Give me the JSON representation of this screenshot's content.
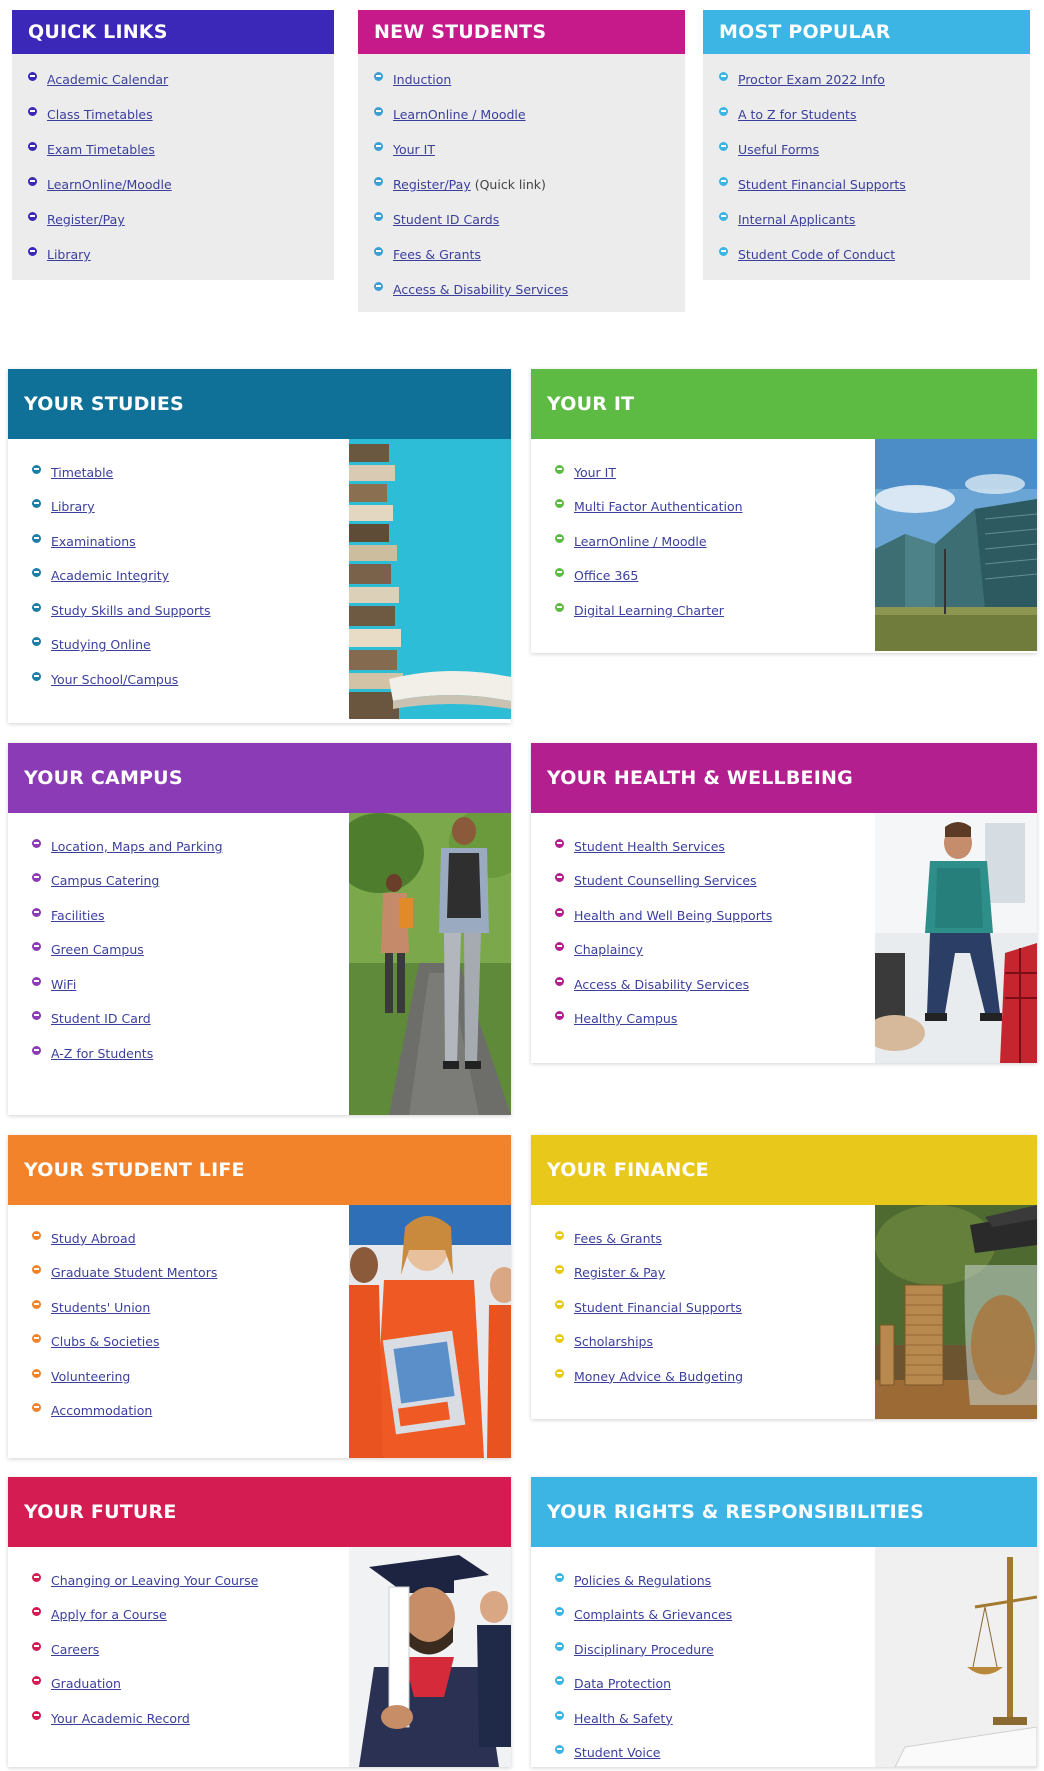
{
  "top": {
    "quick_links": {
      "title": "QUICK LINKS",
      "color": "#3b27b8",
      "bullet": "#3b27b8",
      "items": [
        "Academic Calendar",
        "Class Timetables",
        "Exam Timetables",
        "LearnOnline/Moodle",
        "Register/Pay",
        "Library"
      ]
    },
    "new_students": {
      "title": "NEW STUDENTS",
      "color": "#c61a8b",
      "bullet": "#3b9fd6",
      "items": [
        "Induction",
        "LearnOnline / Moodle",
        "Your IT",
        "Register/Pay",
        "Student ID Cards",
        "Fees & Grants",
        "Access & Disability Services"
      ],
      "register_suffix": "(Quick link)"
    },
    "most_popular": {
      "title": "MOST POPULAR",
      "color": "#3cb4e4",
      "bullet": "#3cb4e4",
      "items": [
        "Proctor Exam 2022 Info",
        "A to Z for Students",
        "Useful Forms",
        "Student Financial Supports",
        "Internal Applicants",
        "Student Code of Conduct"
      ]
    }
  },
  "sections": {
    "studies": {
      "title": "YOUR STUDIES",
      "color": "#0f7197",
      "bullet": "#1a7fa8",
      "items": [
        "Timetable",
        "Library",
        "Examinations",
        "Academic Integrity",
        "Study Skills and Supports",
        "Studying Online",
        "Your School/Campus"
      ]
    },
    "it": {
      "title": "YOUR IT",
      "color": "#5dbb43",
      "bullet": "#5dbb43",
      "items": [
        "Your IT",
        "Multi Factor Authentication",
        "LearnOnline / Moodle",
        "Office 365",
        "Digital Learning Charter"
      ]
    },
    "campus": {
      "title": "YOUR CAMPUS",
      "color": "#8a3bb5",
      "bullet": "#8a3bb5",
      "items": [
        "Location, Maps and Parking",
        "Campus Catering",
        "Facilities",
        "Green Campus",
        "WiFi",
        "Student ID Card",
        "A-Z for Students"
      ]
    },
    "health": {
      "title": "YOUR HEALTH & WELLBEING",
      "color": "#b41f8f",
      "bullet": "#b41f8f",
      "items": [
        "Student Health Services",
        "Student Counselling Services",
        "Health and Well Being Supports",
        "Chaplaincy",
        "Access & Disability Services",
        "Healthy Campus"
      ]
    },
    "life": {
      "title": "YOUR STUDENT LIFE",
      "color": "#f3832b",
      "bullet": "#f3832b",
      "items": [
        "Study Abroad",
        "Graduate Student Mentors",
        "Students' Union",
        "Clubs & Societies",
        "Volunteering",
        "Accommodation"
      ]
    },
    "finance": {
      "title": "YOUR FINANCE",
      "color": "#e9c81c",
      "bullet": "#e9c81c",
      "items": [
        "Fees & Grants",
        "Register & Pay",
        "Student Financial Supports",
        "Scholarships",
        "Money Advice & Budgeting"
      ]
    },
    "future": {
      "title": "YOUR FUTURE",
      "color": "#d41c52",
      "bullet": "#d41c52",
      "items": [
        "Changing or Leaving Your Course",
        "Apply for a Course",
        "Careers",
        "Graduation",
        "Your Academic Record"
      ]
    },
    "rights": {
      "title": "YOUR RIGHTS & RESPONSIBILITIES",
      "color": "#3cb4e4",
      "bullet": "#3cb4e4",
      "items": [
        "Policies & Regulations",
        "Complaints & Grievances",
        "Disciplinary Procedure",
        "Data Protection",
        "Health & Safety",
        "Student Voice"
      ]
    }
  }
}
